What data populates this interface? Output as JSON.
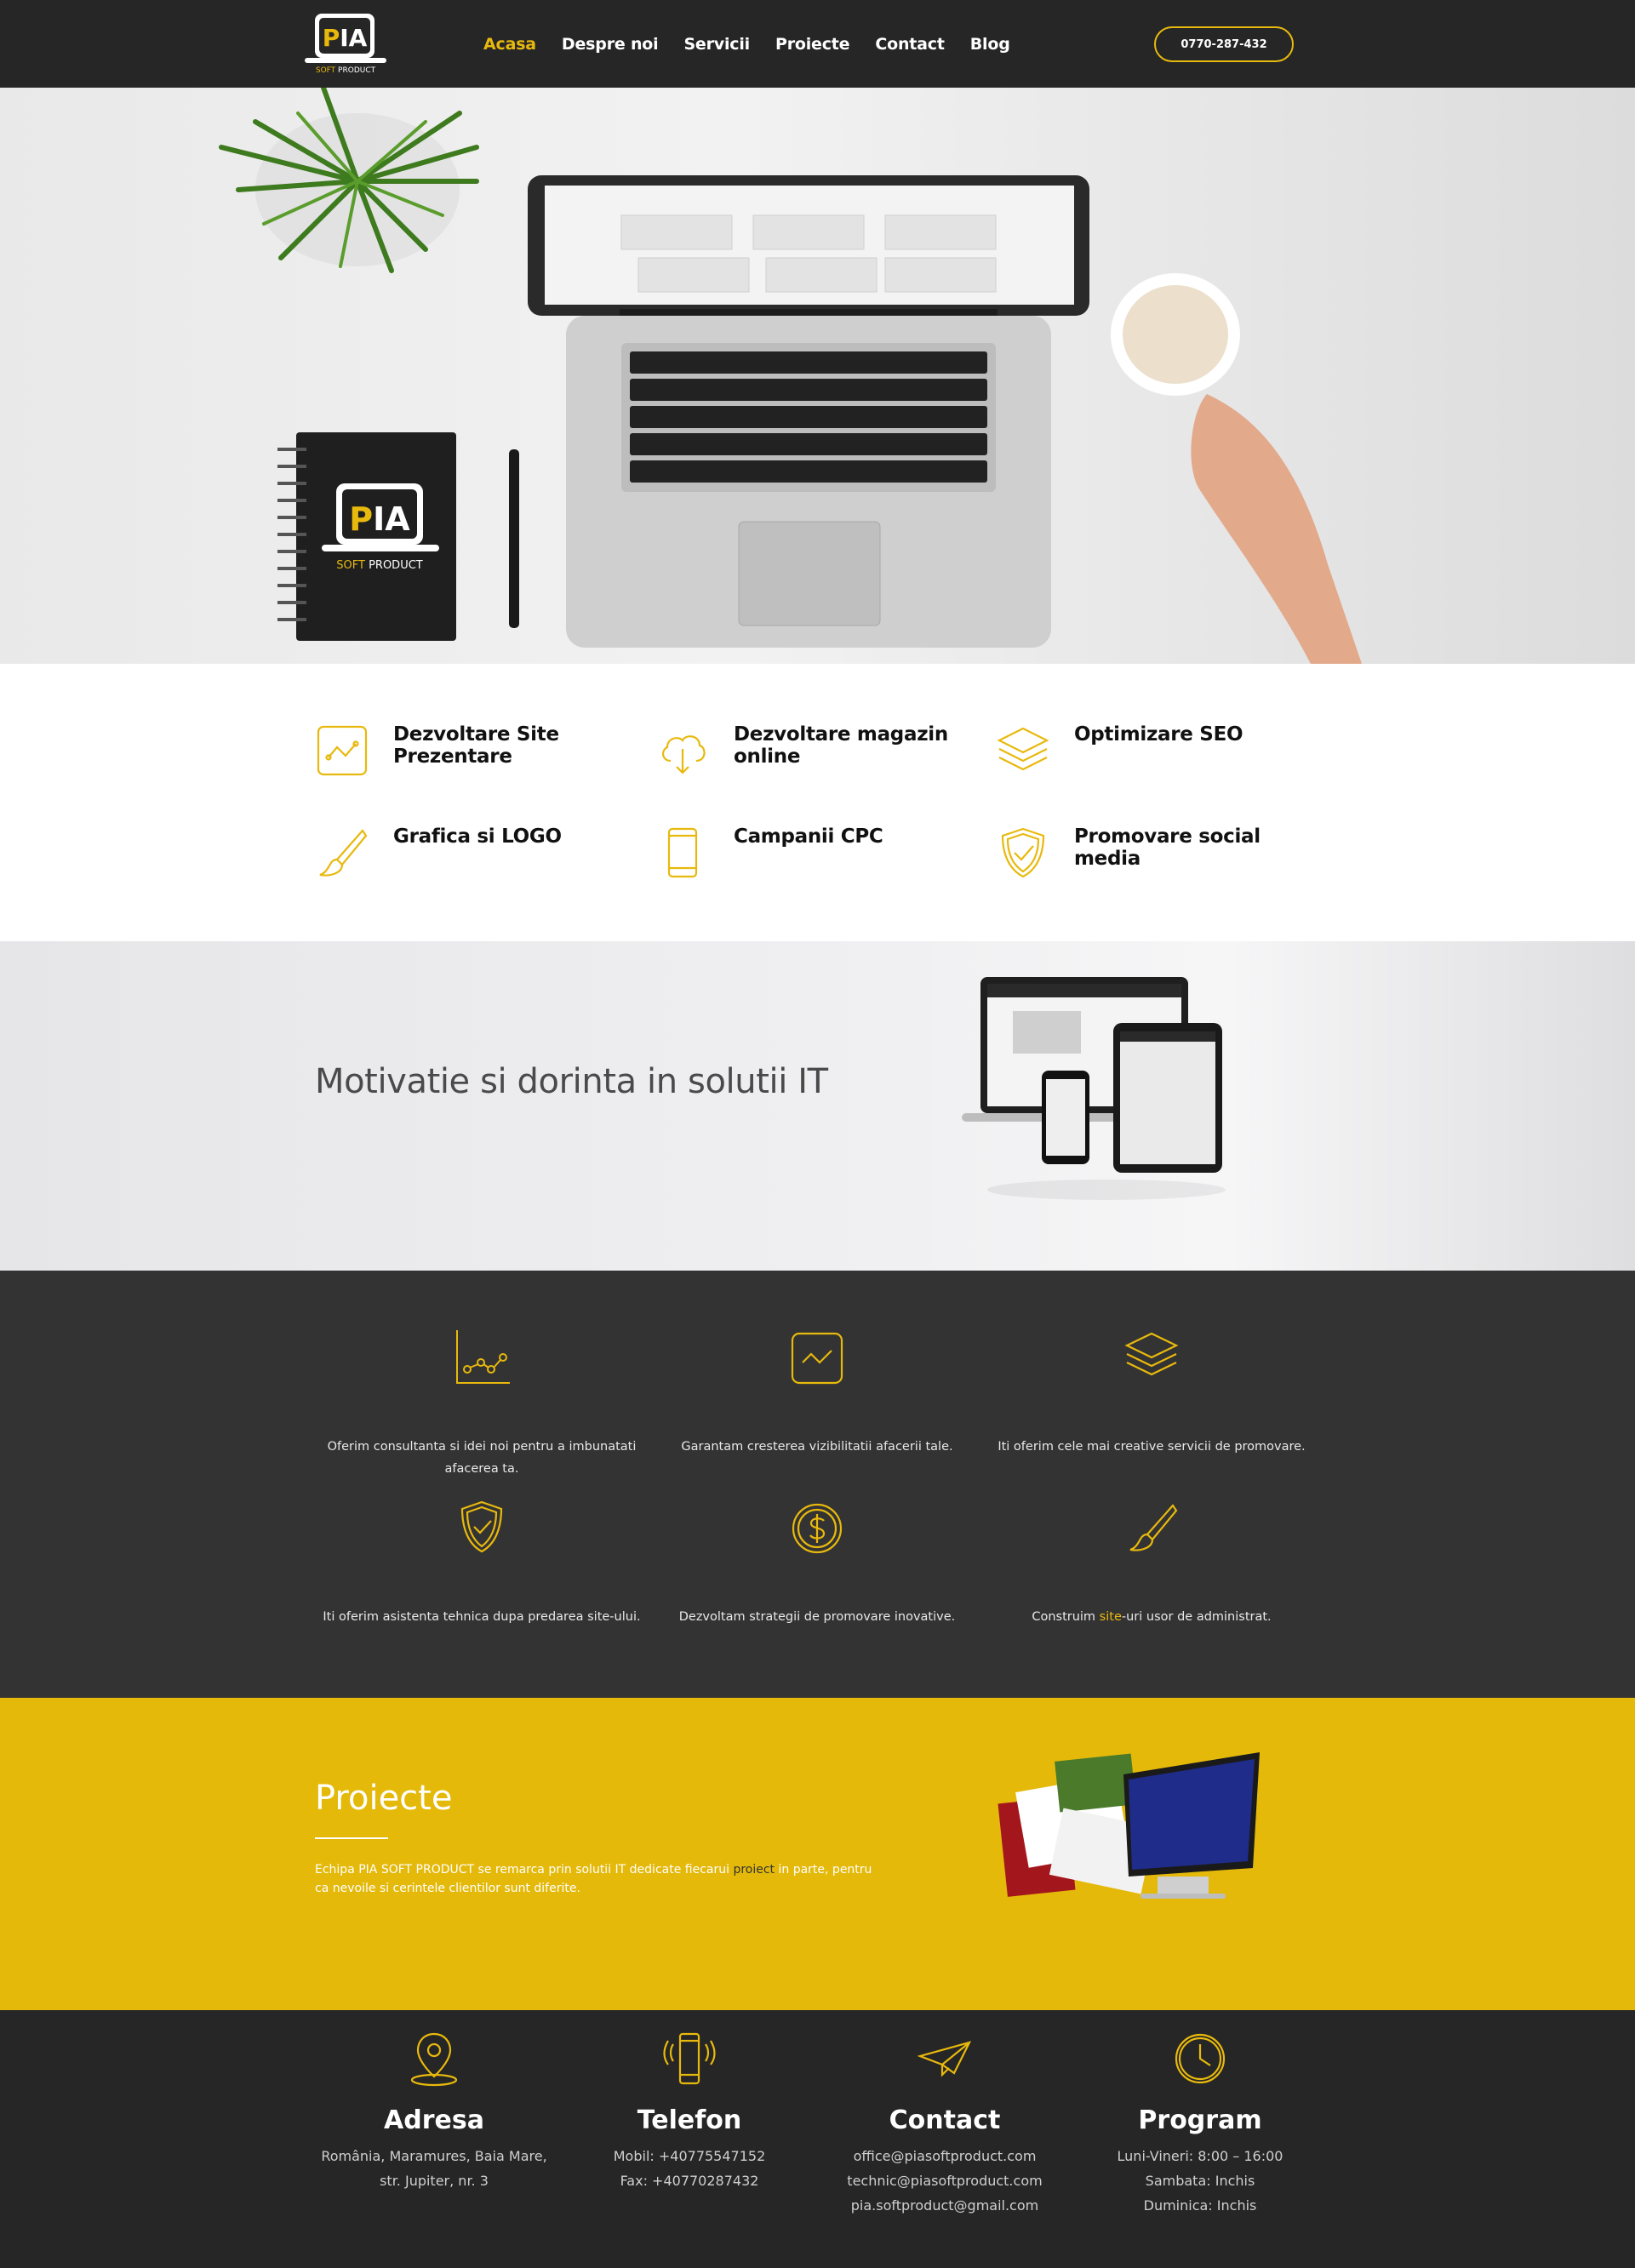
{
  "brand": {
    "logo_text": "PIA",
    "logo_sub": "SOFT PRODUCT",
    "accent": "#e8b90d",
    "dark": "#262626"
  },
  "nav": {
    "items": [
      {
        "label": "Acasa",
        "active": true
      },
      {
        "label": "Despre noi"
      },
      {
        "label": "Servicii"
      },
      {
        "label": "Proiecte"
      },
      {
        "label": "Contact"
      },
      {
        "label": "Blog"
      }
    ],
    "phone": "0770-287-432"
  },
  "hero": {
    "notebook_logo": "PIA",
    "notebook_sub_a": "SOFT",
    "notebook_sub_b": "PRODUCT"
  },
  "services": [
    {
      "label": "Dezvoltare Site Prezentare",
      "icon": "chart-frame-icon"
    },
    {
      "label": "Dezvoltare magazin online",
      "icon": "cloud-download-icon"
    },
    {
      "label": "Optimizare SEO",
      "icon": "layers-icon"
    },
    {
      "label": "Grafica si LOGO",
      "icon": "brush-icon"
    },
    {
      "label": "Campanii CPC",
      "icon": "smartphone-icon"
    },
    {
      "label": "Promovare social media",
      "icon": "shield-check-icon"
    }
  ],
  "motivation": {
    "title": "Motivatie si dorinta in solutii IT"
  },
  "features": [
    {
      "text": "Oferim consultanta si idei noi pentru a imbunatati afacerea ta.",
      "icon": "line-chart-icon"
    },
    {
      "text": "Garantam cresterea vizibilitatii afacerii tale.",
      "icon": "chart-frame-icon"
    },
    {
      "text": "Iti oferim cele mai creative servicii de promovare.",
      "icon": "layers-icon"
    },
    {
      "text": "Iti oferim asistenta tehnica dupa predarea site-ului.",
      "icon": "shield-check-icon"
    },
    {
      "text": "Dezvoltam strategii de promovare inovative.",
      "icon": "dollar-coin-icon"
    },
    {
      "text_a": "Construim ",
      "text_hl": "site",
      "text_b": "-uri usor de administrat.",
      "icon": "brush-icon"
    }
  ],
  "projects": {
    "title": "Proiecte",
    "text_a": "Echipa PIA SOFT PRODUCT se remarca prin solutii IT dedicate fiecarui ",
    "text_hl": "proiect",
    "text_b": " in parte, pentru ca nevoile si cerintele clientilor sunt diferite."
  },
  "footer": {
    "columns": [
      {
        "title": "Adresa",
        "icon": "map-pin-icon",
        "lines": [
          "România, Maramures, Baia Mare,",
          "str. Jupiter, nr. 3"
        ]
      },
      {
        "title": "Telefon",
        "icon": "phone-vibrate-icon",
        "lines": [
          "Mobil: +40775547152",
          "Fax: +40770287432"
        ]
      },
      {
        "title": "Contact",
        "icon": "paper-plane-icon",
        "lines": [
          "office@piasoftproduct.com",
          "technic@piasoftproduct.com",
          "pia.softproduct@gmail.com"
        ]
      },
      {
        "title": "Program",
        "icon": "clock-icon",
        "lines": [
          "Luni-Vineri: 8:00 – 16:00",
          "Sambata: Inchis",
          "Duminica: Inchis"
        ]
      }
    ]
  }
}
